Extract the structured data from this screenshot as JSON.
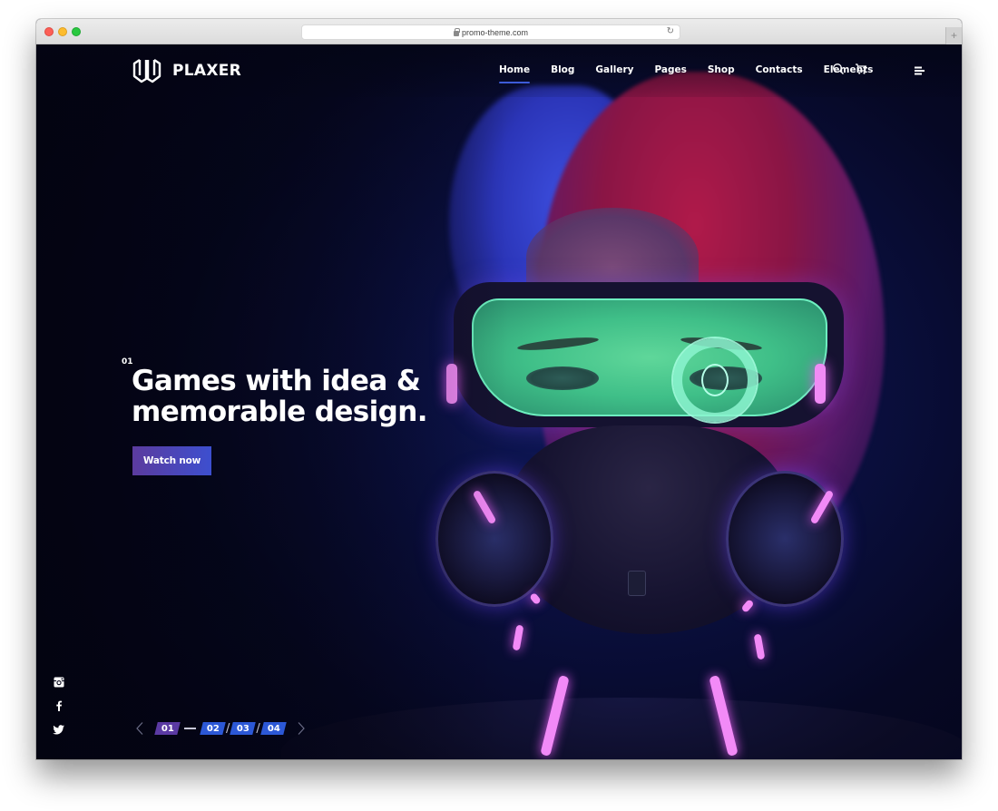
{
  "browser": {
    "url": "promo-theme.com",
    "new_tab_label": "+"
  },
  "site": {
    "logo_text": "PLAXER",
    "nav": [
      {
        "label": "Home",
        "active": true
      },
      {
        "label": "Blog",
        "active": false
      },
      {
        "label": "Gallery",
        "active": false
      },
      {
        "label": "Pages",
        "active": false
      },
      {
        "label": "Shop",
        "active": false
      },
      {
        "label": "Contacts",
        "active": false
      },
      {
        "label": "Elements",
        "active": false
      }
    ],
    "icons": {
      "search": "search-icon",
      "cart": "cart-icon",
      "menu": "hamburger-menu-icon"
    }
  },
  "hero": {
    "slide_number": "01",
    "title_line1": "Games with idea &",
    "title_line2": "memorable design.",
    "cta_label": "Watch now",
    "image_description": "Cyberpunk character with red and blue hair wearing green neon goggles and a gas mask with pink glowing lights"
  },
  "social": [
    {
      "name": "instagram",
      "icon": "instagram-icon"
    },
    {
      "name": "facebook",
      "icon": "facebook-icon"
    },
    {
      "name": "twitter",
      "icon": "twitter-icon"
    }
  ],
  "pager": {
    "prev_icon": "chevron-left-icon",
    "next_icon": "chevron-right-icon",
    "pages": [
      {
        "label": "01",
        "active": true
      },
      {
        "label": "02",
        "active": false
      },
      {
        "label": "03",
        "active": false
      },
      {
        "label": "04",
        "active": false
      }
    ]
  },
  "colors": {
    "accent_blue": "#2c58d6",
    "accent_purple": "#5b3aa3",
    "background": "#05061a",
    "nav_underline": "#3d5bd8"
  }
}
